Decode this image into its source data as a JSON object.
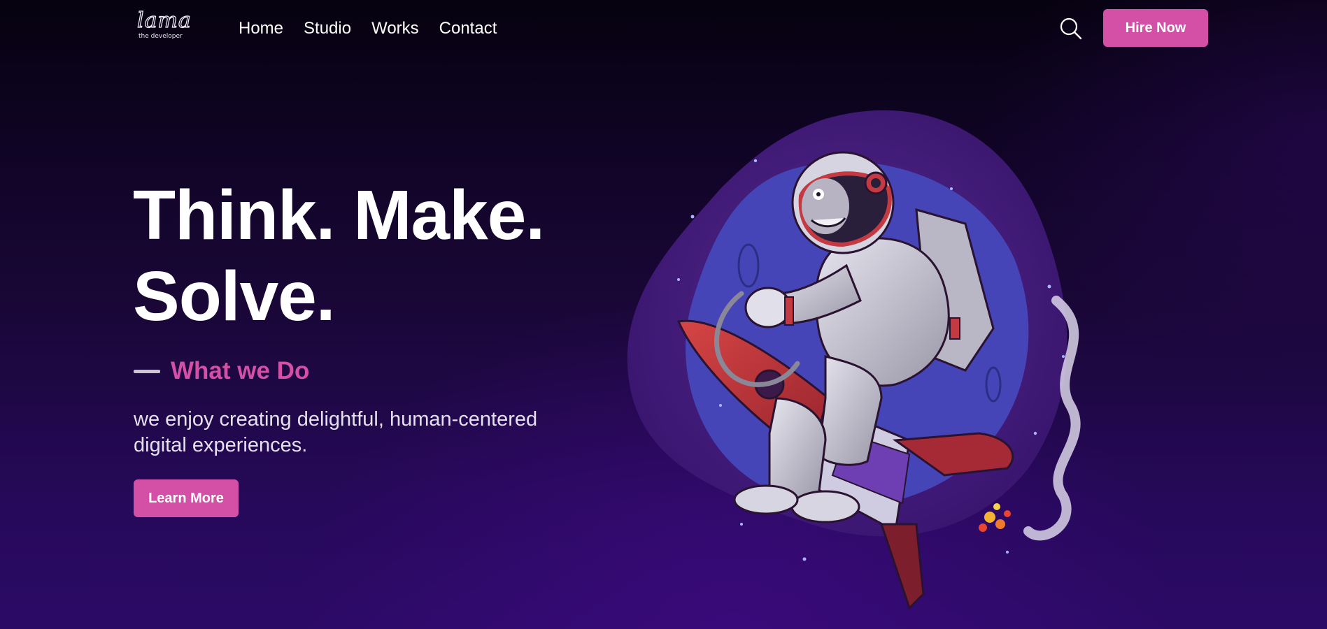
{
  "header": {
    "logo": {
      "script_text": "lama",
      "tagline": "the developer"
    },
    "nav_items": [
      {
        "label": "Home"
      },
      {
        "label": "Studio"
      },
      {
        "label": "Works"
      },
      {
        "label": "Contact"
      }
    ],
    "search_icon": "search-icon",
    "hire_button_label": "Hire Now"
  },
  "hero": {
    "title_line_1": "Think. Make.",
    "title_line_2": "Solve.",
    "eyebrow": "What we Do",
    "description": "we enjoy creating delightful, human-centered digital experiences.",
    "cta_label": "Learn More",
    "illustration": "astronaut-riding-rocket"
  },
  "colors": {
    "accent": "#d44fa6",
    "background_dark": "#06020f",
    "background_purple": "#2b0a66",
    "text": "#ffffff"
  }
}
